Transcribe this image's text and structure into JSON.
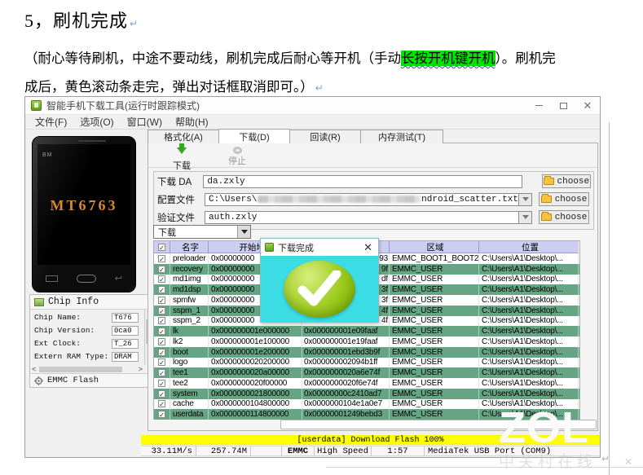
{
  "document": {
    "heading": "5，刷机完成",
    "para_line1_pre": "（耐心等待刷机，中途不要动线，刷机完成后耐心等开机（手动",
    "para_highlight": "长按开机键开机",
    "para_line1_post": "）。刷机完",
    "para_line2": "成后，黄色滚动条走完，弹出对话框取消即可。）"
  },
  "window": {
    "title": "智能手机下载工具(运行时跟踪模式)",
    "menu": [
      "文件(F)",
      "选项(O)",
      "窗口(W)",
      "帮助(H)"
    ],
    "tabs": [
      {
        "label": "格式化(A)",
        "active": false
      },
      {
        "label": "下载(D)",
        "active": true
      },
      {
        "label": "回读(R)",
        "active": false
      },
      {
        "label": "内存测试(T)",
        "active": false
      }
    ],
    "toolbar": {
      "download_label": "下载",
      "stop_label": "停止"
    },
    "fields": [
      {
        "label": "下载 DA",
        "value": "da.zxly",
        "choose_label": "choose"
      },
      {
        "label": "配置文件",
        "value_prefix": "C:\\Users\\",
        "value_blurred": true,
        "value_suffix": "ndroid_scatter.txt",
        "choose_label": "choose"
      },
      {
        "label": "验证文件",
        "value": "auth.zxly",
        "choose_label": "choose"
      }
    ],
    "mode_dropdown_value": "下载",
    "table": {
      "headers": [
        "名字",
        "开始地址",
        "",
        "区域",
        "位置"
      ],
      "rows": [
        {
          "checked": true,
          "name": "preloader",
          "start": "0x00000000",
          "end": "93",
          "region": "EMMC_BOOT1_BOOT2",
          "location": "C:\\Users\\A1\\Desktop\\..."
        },
        {
          "checked": true,
          "name": "recovery",
          "start": "0x00000000",
          "end": "9f",
          "region": "EMMC_USER",
          "location": "C:\\Users\\A1\\Desktop\\..."
        },
        {
          "checked": true,
          "name": "md1img",
          "start": "0x00000000",
          "end": "df",
          "region": "EMMC_USER",
          "location": "C:\\Users\\A1\\Desktop\\..."
        },
        {
          "checked": true,
          "name": "md1dsp",
          "start": "0x00000000",
          "end": "3f",
          "region": "EMMC_USER",
          "location": "C:\\Users\\A1\\Desktop\\..."
        },
        {
          "checked": true,
          "name": "spmfw",
          "start": "0x00000000",
          "end": "3f",
          "region": "EMMC_USER",
          "location": "C:\\Users\\A1\\Desktop\\..."
        },
        {
          "checked": true,
          "name": "sspm_1",
          "start": "0x00000000",
          "end": "4f",
          "region": "EMMC_USER",
          "location": "C:\\Users\\A1\\Desktop\\..."
        },
        {
          "checked": true,
          "name": "sspm_2",
          "start": "0x00000000",
          "end": "4f",
          "region": "EMMC_USER",
          "location": "C:\\Users\\A1\\Desktop\\..."
        },
        {
          "checked": true,
          "name": "lk",
          "start": "0x000000001e000000",
          "end": "0x000000001e09faaf",
          "region": "EMMC_USER",
          "location": "C:\\Users\\A1\\Desktop\\..."
        },
        {
          "checked": true,
          "name": "lk2",
          "start": "0x000000001e100000",
          "end": "0x000000001e19faaf",
          "region": "EMMC_USER",
          "location": "C:\\Users\\A1\\Desktop\\..."
        },
        {
          "checked": true,
          "name": "boot",
          "start": "0x000000001e200000",
          "end": "0x000000001ebd3b9f",
          "region": "EMMC_USER",
          "location": "C:\\Users\\A1\\Desktop\\..."
        },
        {
          "checked": true,
          "name": "logo",
          "start": "0x0000000020200000",
          "end": "0x000000002094b1ff",
          "region": "EMMC_USER",
          "location": "C:\\Users\\A1\\Desktop\\..."
        },
        {
          "checked": true,
          "name": "tee1",
          "start": "0x0000000020a00000",
          "end": "0x0000000020a6e74f",
          "region": "EMMC_USER",
          "location": "C:\\Users\\A1\\Desktop\\..."
        },
        {
          "checked": true,
          "name": "tee2",
          "start": "0x0000000020f00000",
          "end": "0x0000000020f6e74f",
          "region": "EMMC_USER",
          "location": "C:\\Users\\A1\\Desktop\\..."
        },
        {
          "checked": true,
          "name": "system",
          "start": "0x0000000021800000",
          "end": "0x00000000c2410ad7",
          "region": "EMMC_USER",
          "location": "C:\\Users\\A1\\Desktop\\..."
        },
        {
          "checked": true,
          "name": "cache",
          "start": "0x0000000104800000",
          "end": "0x0000000104e1a0e7",
          "region": "EMMC_USER",
          "location": "C:\\Users\\A1\\Desktop\\..."
        },
        {
          "checked": true,
          "name": "userdata",
          "start": "0x0000000114800000",
          "end": "0x00000001249bebd3",
          "region": "EMMC_USER",
          "location": "C:\\Users\\A1\\Desktop\\..."
        }
      ]
    },
    "dialog": {
      "title": "下载完成"
    },
    "progress": {
      "label": "[userdata] Download Flash 100%"
    },
    "status": [
      "33.11M/s",
      "257.74M",
      "",
      "EMMC",
      "High Speed",
      "1:57",
      "MediaTek USB Port (COM9)"
    ],
    "chip_info": {
      "header": "Chip Info",
      "rows": [
        {
          "label": "Chip Name:",
          "value": "T676"
        },
        {
          "label": "Chip Version:",
          "value": "0ca0"
        },
        {
          "label": "Ext Clock:",
          "value": "T_26"
        },
        {
          "label": "Extern RAM Type:",
          "value": "DRAM"
        }
      ],
      "footer": "EMMC Flash"
    },
    "phone": {
      "brand": "BM",
      "chip_label": "MT6763"
    }
  },
  "watermark": {
    "logo": "ZOL",
    "text": "中关村在线"
  },
  "colors": {
    "highlight_green": "#00e400",
    "table_row_green": "#66a583",
    "table_header_lavender": "#cdcdf2",
    "progress_yellow": "#ffff00",
    "dialog_cyan": "#3bdce4",
    "check_green": "#9cc91e",
    "phone_text_orange": "#d8882e"
  }
}
